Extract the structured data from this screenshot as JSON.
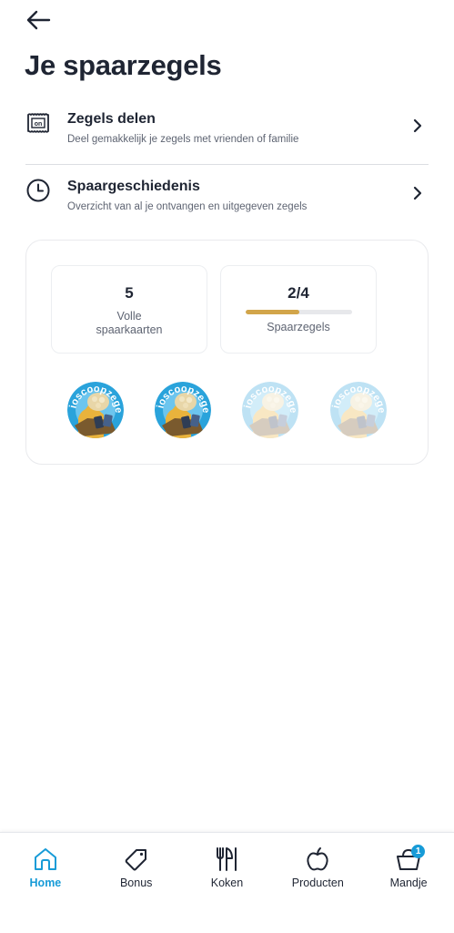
{
  "header": {
    "title": "Je spaarzegels"
  },
  "menu": [
    {
      "title": "Zegels delen",
      "subtitle": "Deel gemakkelijk je zegels met vrienden of familie",
      "icon": "stamp-share-icon"
    },
    {
      "title": "Spaargeschiedenis",
      "subtitle": "Overzicht van al je ontvangen en uitgegeven zegels",
      "icon": "clock-icon"
    }
  ],
  "stats": {
    "full_cards": {
      "value": "5",
      "label_line1": "Volle",
      "label_line2": "spaarkaarten"
    },
    "stamps": {
      "value": "2/4",
      "label": "Spaarzegels",
      "progress": 0.5
    }
  },
  "stamps": [
    {
      "text": "Bioscoopzegel",
      "collected": true
    },
    {
      "text": "Bioscoopzegel",
      "collected": true
    },
    {
      "text": "Bioscoopzegel",
      "collected": false
    },
    {
      "text": "Bioscoopzegel",
      "collected": false
    }
  ],
  "nav": {
    "items": [
      {
        "label": "Home",
        "icon": "home-icon",
        "active": true
      },
      {
        "label": "Bonus",
        "icon": "tag-icon",
        "active": false
      },
      {
        "label": "Koken",
        "icon": "cutlery-icon",
        "active": false
      },
      {
        "label": "Producten",
        "icon": "apple-icon",
        "active": false
      },
      {
        "label": "Mandje",
        "icon": "basket-icon",
        "active": false,
        "badge": "1"
      }
    ]
  },
  "colors": {
    "accent": "#179bd7",
    "progress": "#d2a54a",
    "text": "#1f2533",
    "muted": "#5e6472"
  }
}
